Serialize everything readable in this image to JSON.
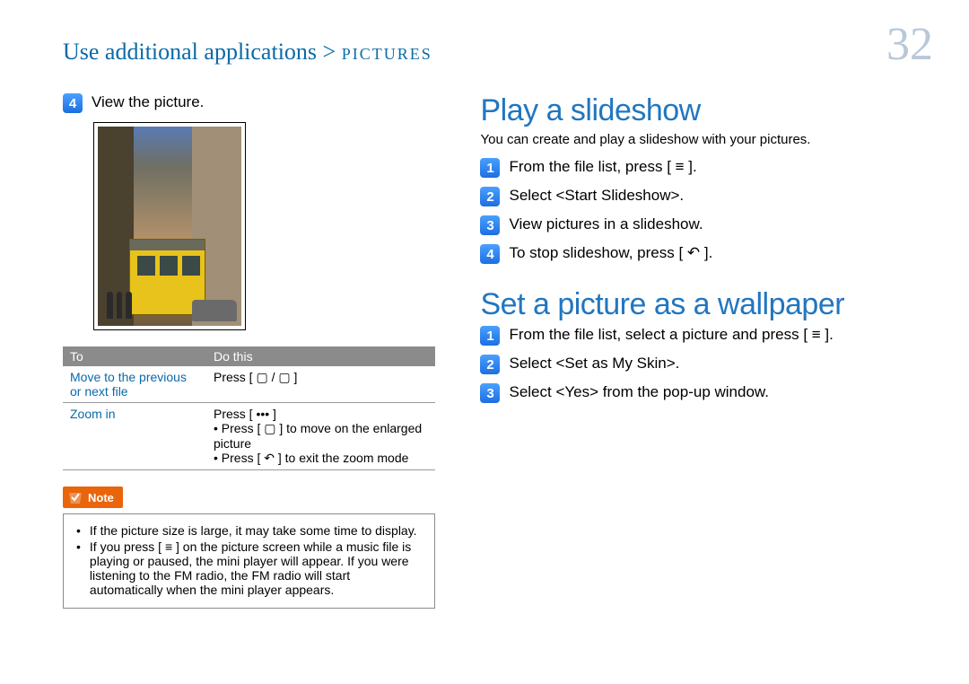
{
  "header": {
    "breadcrumb_main": "Use additional applications > ",
    "breadcrumb_sub": "PICTURES",
    "page_number": "32"
  },
  "left": {
    "step4": "View the picture.",
    "table": {
      "head_to": "To",
      "head_do": "Do this",
      "row1_to": "Move to the previous or next file",
      "row1_do": "Press [ ▢ / ▢ ]",
      "row2_to": "Zoom in",
      "row2_do_line1": "Press [ ••• ]",
      "row2_do_b1": "Press [ ▢ ] to move on the enlarged picture",
      "row2_do_b2": "Press [ ↶ ] to exit the zoom mode"
    },
    "note_label": "Note",
    "note_b1": "If the picture size is large, it may take some time to display.",
    "note_b2": "If you press [ ≡ ] on the picture screen while a music file is playing or paused, the mini player will appear. If you were listening to the FM radio, the FM radio will start automatically when the mini player appears."
  },
  "right": {
    "slideshow": {
      "title": "Play a slideshow",
      "intro": "You can create and play a slideshow with your pictures.",
      "s1": "From the file list, press [ ≡ ].",
      "s2": "Select <Start Slideshow>.",
      "s3": "View pictures in a slideshow.",
      "s4": "To stop slideshow, press [ ↶ ]."
    },
    "wallpaper": {
      "title": "Set a picture as a wallpaper",
      "s1": "From the file list, select a picture and press [ ≡ ].",
      "s2": "Select <Set as My Skin>.",
      "s3": "Select <Yes> from the pop-up window."
    }
  }
}
